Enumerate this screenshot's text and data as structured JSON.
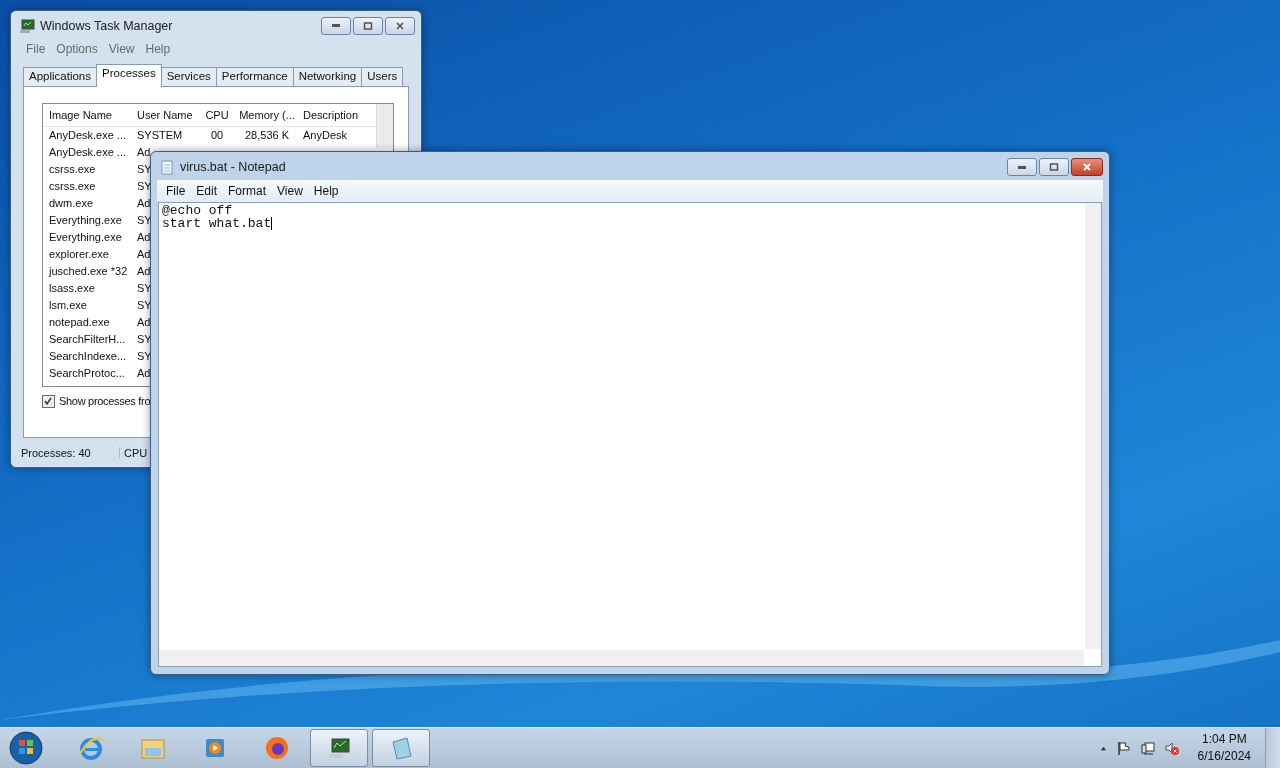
{
  "task_manager": {
    "title": "Windows Task Manager",
    "menu": [
      "File",
      "Options",
      "View",
      "Help"
    ],
    "tabs": [
      {
        "label": "Applications",
        "selected": false
      },
      {
        "label": "Processes",
        "selected": true
      },
      {
        "label": "Services",
        "selected": false
      },
      {
        "label": "Performance",
        "selected": false
      },
      {
        "label": "Networking",
        "selected": false
      },
      {
        "label": "Users",
        "selected": false
      }
    ],
    "columns": [
      "Image Name",
      "User Name",
      "CPU",
      "Memory (...",
      "Description"
    ],
    "rows": [
      {
        "cells": [
          "AnyDesk.exe ...",
          "SYSTEM",
          "00",
          "28,536 K",
          "AnyDesk"
        ]
      },
      {
        "cells": [
          "AnyDesk.exe ...",
          "Ad"
        ]
      },
      {
        "cells": [
          "csrss.exe",
          "SY"
        ]
      },
      {
        "cells": [
          "csrss.exe",
          "SY"
        ]
      },
      {
        "cells": [
          "dwm.exe",
          "Ad"
        ]
      },
      {
        "cells": [
          "Everything.exe",
          "SY"
        ]
      },
      {
        "cells": [
          "Everything.exe",
          "Ad"
        ]
      },
      {
        "cells": [
          "explorer.exe",
          "Ad"
        ]
      },
      {
        "cells": [
          "jusched.exe *32",
          "Ad"
        ]
      },
      {
        "cells": [
          "lsass.exe",
          "SY"
        ]
      },
      {
        "cells": [
          "lsm.exe",
          "SY"
        ]
      },
      {
        "cells": [
          "notepad.exe",
          "Ad"
        ]
      },
      {
        "cells": [
          "SearchFilterH...",
          "SY"
        ]
      },
      {
        "cells": [
          "SearchIndexe...",
          "SY"
        ]
      },
      {
        "cells": [
          "SearchProtoc...",
          "Ad"
        ]
      }
    ],
    "show_all": {
      "label": "Show processes fro",
      "checked": true
    },
    "status_bar": [
      "Processes: 40",
      "CPU"
    ]
  },
  "notepad": {
    "title": "virus.bat - Notepad",
    "menu": [
      "File",
      "Edit",
      "Format",
      "View",
      "Help"
    ],
    "lines": [
      "@echo off",
      "start what.bat"
    ]
  },
  "taskbar": {
    "apps": [
      {
        "kind": "ie",
        "active": false
      },
      {
        "kind": "explorer",
        "active": false
      },
      {
        "kind": "media",
        "active": false
      },
      {
        "kind": "firefox",
        "active": false
      },
      {
        "kind": "taskmgr",
        "active": true
      },
      {
        "kind": "notepad",
        "active": true
      }
    ],
    "time": "1:04 PM",
    "date": "6/16/2024"
  }
}
